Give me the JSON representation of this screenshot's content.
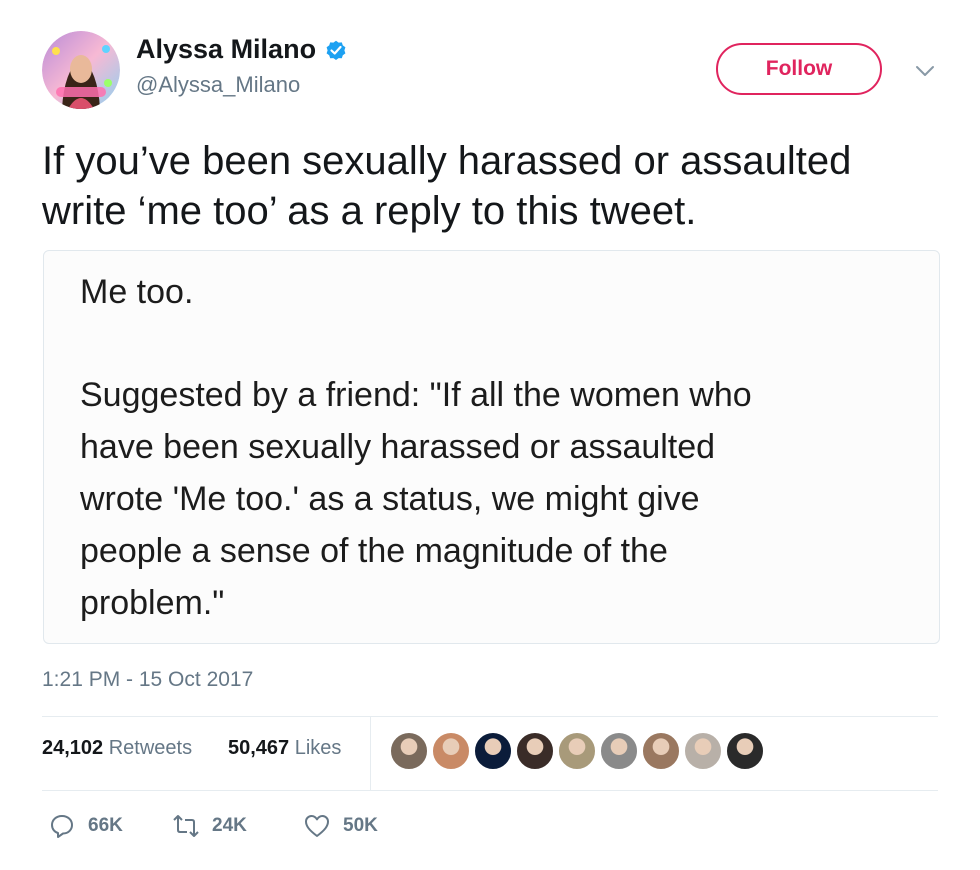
{
  "author": {
    "name": "Alyssa Milano",
    "handle": "@Alyssa_Milano",
    "avatar_icon": "profile-photo-icon",
    "verified_icon": "verified-badge-icon",
    "verified_color": "#1da1f2"
  },
  "follow_button": {
    "label": "Follow",
    "color": "#e0245e"
  },
  "menu_icon": "chevron-down-icon",
  "tweet": {
    "text_line1": "If you’ve been sexually harassed or assaulted",
    "text_line2": "write ‘me too’ as a reply to this tweet."
  },
  "media": {
    "line1": "Me too.",
    "para_line1": "Suggested by a friend: \"If all the women who",
    "para_line2": "have been sexually harassed or assaulted",
    "para_line3": "wrote 'Me too.' as a status, we might give",
    "para_line4": "people a sense of the magnitude of the",
    "para_line5": "problem.\""
  },
  "timestamp": "1:21 PM - 15 Oct 2017",
  "stats": {
    "retweets_count": "24,102",
    "retweets_label": "Retweets",
    "likes_count": "50,467",
    "likes_label": "Likes"
  },
  "liker_avatars": [
    {
      "icon": "liker-avatar-1-icon",
      "color": "#7a6a5c"
    },
    {
      "icon": "liker-avatar-2-icon",
      "color": "#c98a66"
    },
    {
      "icon": "liker-avatar-3-icon",
      "color": "#0b1c3a"
    },
    {
      "icon": "liker-avatar-4-icon",
      "color": "#3a2c28"
    },
    {
      "icon": "liker-avatar-5-icon",
      "color": "#a89a7a"
    },
    {
      "icon": "liker-avatar-6-icon",
      "color": "#8a8a8a"
    },
    {
      "icon": "liker-avatar-7-icon",
      "color": "#9a7860"
    },
    {
      "icon": "liker-avatar-8-icon",
      "color": "#b8b0a8"
    },
    {
      "icon": "liker-avatar-9-icon",
      "color": "#2a2a2a"
    }
  ],
  "actions": {
    "reply_icon": "reply-icon",
    "reply_count": "66K",
    "retweet_icon": "retweet-icon",
    "retweet_count": "24K",
    "like_icon": "heart-icon",
    "like_count": "50K"
  }
}
